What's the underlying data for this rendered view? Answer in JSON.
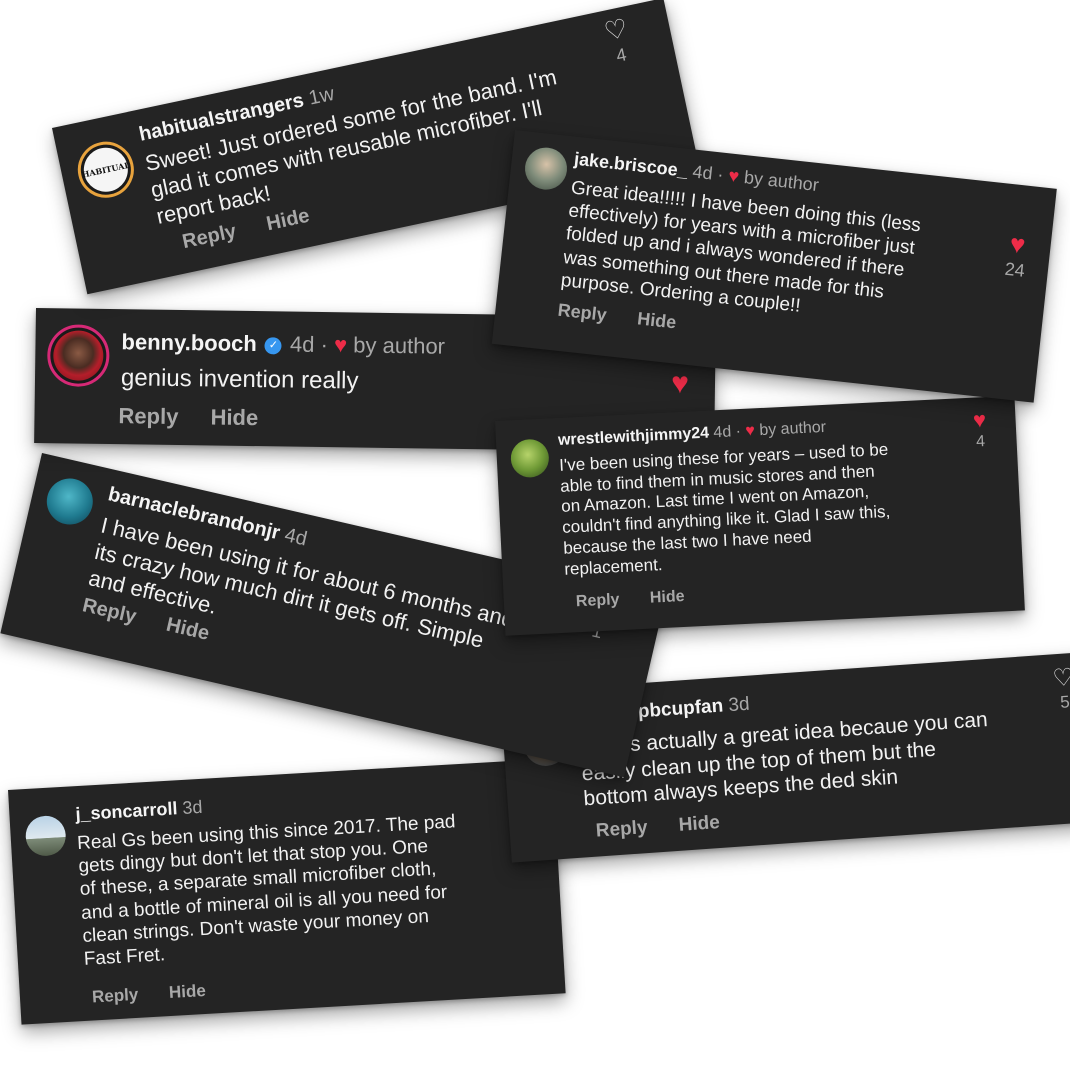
{
  "comments": [
    {
      "username": "habitualstrangers",
      "avatar_text": "HABITUAL",
      "time": "1w",
      "text_lines": [
        "Sweet! Just ordered some for the band. I'm",
        "glad it comes with reusable microfiber. I'll",
        "report back!"
      ],
      "reply": "Reply",
      "hide": "Hide",
      "like_icon": "heart-outline-icon",
      "likes": "4"
    },
    {
      "username": "jake.briscoe_",
      "time": "4d ·",
      "by_author": "by author",
      "text_lines": [
        "Great idea!!!!! I have been doing this (less",
        "effectively) for years with a microfiber just",
        "folded up and i always wondered if there",
        "was something out there made for this",
        "purpose. Ordering a couple!!"
      ],
      "reply": "Reply",
      "hide": "Hide",
      "like_icon": "heart-filled-icon",
      "likes": "24"
    },
    {
      "username": "benny.booch",
      "time": "4d ·",
      "by_author": "by author",
      "text_lines": [
        "genius invention really"
      ],
      "reply": "Reply",
      "hide": "Hide",
      "like_icon": "heart-filled-icon"
    },
    {
      "username": "wrestlewithjimmy24",
      "time": "4d ·",
      "by_author": "by author",
      "text_lines": [
        "I've been using these for years – used to be",
        "able to find them in music stores and then",
        "on Amazon. Last time I went on Amazon,",
        "couldn't find anything like it. Glad I saw this,",
        "because the last two I have need",
        "replacement."
      ],
      "reply": "Reply",
      "hide": "Hide",
      "like_icon": "heart-filled-icon",
      "likes": "4"
    },
    {
      "username": "barnaclebrandonjr",
      "time": "4d",
      "text_lines": [
        "I have been using it for about 6 months and",
        "its crazy how much dirt it gets off.  Simple",
        "and effective."
      ],
      "reply": "Reply",
      "hide": "Hide",
      "like_icon": "heart-outline-icon",
      "likes": "1"
    },
    {
      "username": "reesespbcupfan",
      "time": "3d",
      "text_lines": [
        "This is actually a great idea becaue you can",
        "easily clean up the top of them but the",
        "bottom always keeps the ded skin"
      ],
      "reply": "Reply",
      "hide": "Hide",
      "like_icon": "heart-outline-icon",
      "likes": "5"
    },
    {
      "username": "j_soncarroll",
      "time": "3d",
      "text_lines": [
        "Real Gs been using this since 2017. The pad",
        "gets dingy but don't let that stop you. One",
        "of these, a separate small microfiber cloth,",
        "and a bottle of mineral oil is all you need for",
        "clean strings. Don't waste your money on",
        "Fast Fret."
      ],
      "reply": "Reply",
      "hide": "Hide",
      "like_icon": "heart-outline-icon"
    }
  ],
  "colors": {
    "card_bg": "#242424",
    "text": "#f2f2f2",
    "muted": "#a8a8a8",
    "like_red": "#ed2c48",
    "verified_blue": "#3797f0"
  }
}
